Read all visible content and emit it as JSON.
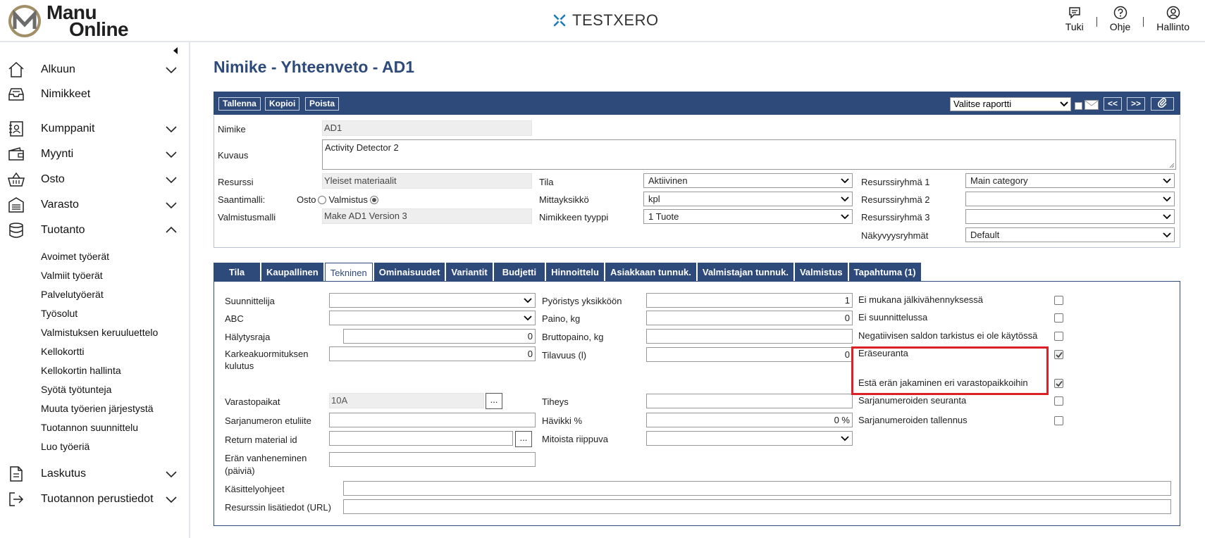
{
  "header": {
    "logo_line1": "Manu",
    "logo_line2": "Online",
    "brand": "TESTXERO",
    "actions": [
      {
        "label": "Tuki",
        "icon": "chat-icon"
      },
      {
        "label": "Ohje",
        "icon": "help-icon"
      },
      {
        "label": "Hallinto",
        "icon": "user-icon"
      }
    ]
  },
  "sidebar": {
    "items": [
      {
        "label": "Alkuun",
        "icon": "home-icon"
      },
      {
        "label": "Nimikkeet",
        "icon": "inbox-icon"
      },
      {
        "label": "Kumppanit",
        "icon": "contacts-icon"
      },
      {
        "label": "Myynti",
        "icon": "wallet-icon"
      },
      {
        "label": "Osto",
        "icon": "basket-icon"
      },
      {
        "label": "Varasto",
        "icon": "warehouse-icon"
      },
      {
        "label": "Tuotanto",
        "icon": "database-icon"
      },
      {
        "label": "Laskutus",
        "icon": "document-icon"
      },
      {
        "label": "Tuotannon perustiedot",
        "icon": "logout-icon"
      }
    ],
    "subitems": [
      "Avoimet työerät",
      "Valmiit työerät",
      "Palvelutyöerät",
      "Työsolut",
      "Valmistuksen keruuluettelo",
      "Kellokortti",
      "Kellokortin hallinta",
      "Syötä työtunteja",
      "Muuta työerien järjestystä",
      "Tuotannon suunnittelu",
      "Luo työeriä"
    ]
  },
  "page": {
    "title": "Nimike - Yhteenveto - AD1"
  },
  "toolbar": {
    "save": "Tallenna",
    "copy": "Kopioi",
    "delete": "Poista",
    "report_select": "Valitse raportti",
    "prev": "<<",
    "next": ">>"
  },
  "form": {
    "nimike_label": "Nimike",
    "nimike_value": "AD1",
    "kuvaus_label": "Kuvaus",
    "kuvaus_value": "Activity Detector 2",
    "resurssi_label": "Resurssi",
    "resurssi_value": "Yleiset materiaalit",
    "saantimalli_label": "Saantimalli:",
    "osto_label": "Osto",
    "valmistus_label": "Valmistus",
    "valmistusmalli_label": "Valmistusmalli",
    "valmistusmalli_value": "Make AD1 Version 3",
    "tila_label": "Tila",
    "tila_value": "Aktiivinen",
    "mittayksikko_label": "Mittayksikkö",
    "mittayksikko_value": "kpl",
    "nimikkeen_tyyppi_label": "Nimikkeen tyyppi",
    "nimikkeen_tyyppi_value": "1 Tuote",
    "rg1_label": "Resurssiryhmä 1",
    "rg1_value": "Main category",
    "rg2_label": "Resurssiryhmä 2",
    "rg2_value": "",
    "rg3_label": "Resurssiryhmä 3",
    "rg3_value": "",
    "nakyvyys_label": "Näkyvyysryhmät",
    "nakyvyys_value": "Default"
  },
  "tabs": [
    "Tila",
    "Kaupallinen",
    "Tekninen",
    "Ominaisuudet",
    "Variantit",
    "Budjetti",
    "Hinnoittelu",
    "Asiakkaan tunnuk.",
    "Valmistajan tunnuk.",
    "Valmistus",
    "Tapahtuma (1)"
  ],
  "tekninen": {
    "suunnittelija_label": "Suunnittelija",
    "abc_label": "ABC",
    "halytysraja_label": "Hälytysraja",
    "halytysraja_value": "0",
    "karkea_label1": "Karkeakuormituksen",
    "karkea_label2": "kulutus",
    "karkea_value": "0",
    "varastopaikat_label": "Varastopaikat",
    "varastopaikat_value": "10A",
    "sarjanumeron_etuliite_label": "Sarjanumeron etuliite",
    "return_material_label": "Return material id",
    "eran_vanheneminen_label1": "Erän vanheneminen",
    "eran_vanheneminen_label2": "(päiviä)",
    "kasittely_label": "Käsittelyohjeet",
    "lisatiedot_label": "Resurssin lisätiedot (URL)",
    "pyoristys_label": "Pyöristys yksikköön",
    "pyoristys_value": "1",
    "paino_label": "Paino, kg",
    "paino_value": "0",
    "bruttopaino_label": "Bruttopaino, kg",
    "tilavuus_label": "Tilavuus (l)",
    "tilavuus_value": "0",
    "tiheys_label": "Tiheys",
    "havikki_label": "Hävikki %",
    "havikki_value": "0 %",
    "mitoista_label": "Mitoista riippuva",
    "ellipsis": "...",
    "checks": [
      {
        "label": "Ei mukana jälkivähennyksessä",
        "checked": false
      },
      {
        "label": "Ei suunnittelussa",
        "checked": false
      },
      {
        "label": "Negatiivisen saldon tarkistus ei ole käytössä",
        "checked": false
      },
      {
        "label": "Eräseuranta",
        "checked": true
      },
      {
        "label": "Estä erän jakaminen eri varastopaikkoihin",
        "checked": true
      },
      {
        "label": "Sarjanumeroiden seuranta",
        "checked": false
      },
      {
        "label": "Sarjanumeroiden tallennus",
        "checked": false
      }
    ]
  },
  "colors": {
    "primary": "#2d4a7a",
    "highlight": "#dd1f26"
  }
}
